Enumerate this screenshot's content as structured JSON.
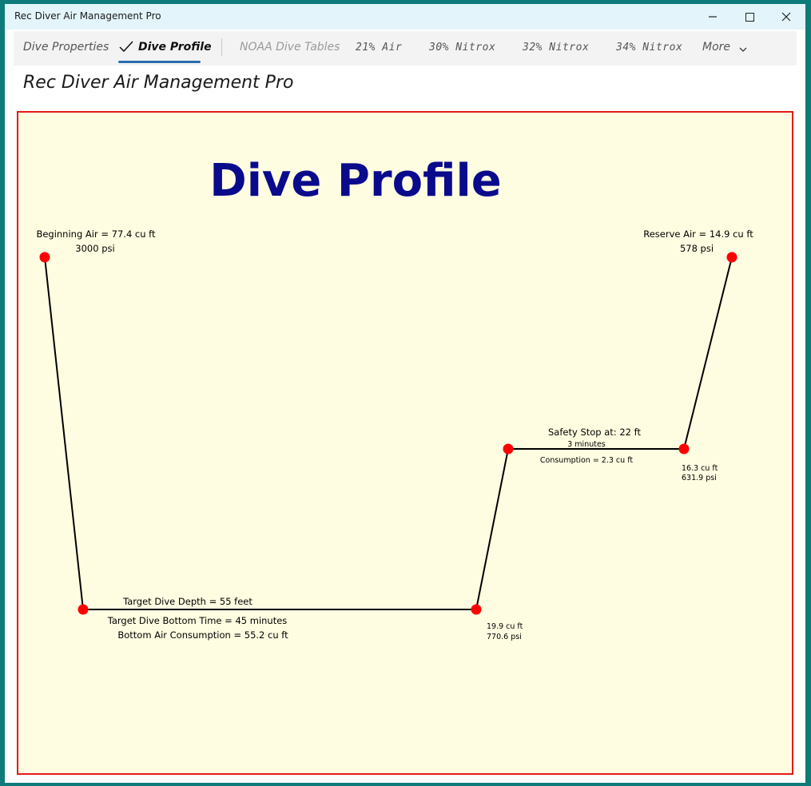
{
  "window": {
    "title": "Rec Diver Air Management Pro",
    "controls": {
      "minimize": "minimize-icon",
      "maximize": "maximize-icon",
      "close": "close-icon"
    }
  },
  "tabs": [
    {
      "label": "Dive Properties",
      "state": "normal"
    },
    {
      "label": "Dive Profile",
      "state": "selected"
    },
    {
      "label": "NOAA Dive Tables",
      "state": "disabled"
    },
    {
      "label": "21% Air",
      "state": "normal"
    },
    {
      "label": "30% Nitrox",
      "state": "normal"
    },
    {
      "label": "32% Nitrox",
      "state": "normal"
    },
    {
      "label": "34% Nitrox",
      "state": "normal"
    },
    {
      "label": "More",
      "state": "overflow"
    }
  ],
  "page_title": "Rec Diver Air Management Pro",
  "profile": {
    "heading": "Dive Profile",
    "colors": {
      "heading": "#0a0a8c",
      "point": "#ff0000",
      "line": "#000000",
      "canvas": "#fffde1",
      "frame": "#e21a1a"
    },
    "beginning": {
      "air": "Beginning Air = 77.4 cu ft",
      "psi": "3000 psi"
    },
    "bottom": {
      "depth": "Target Dive Depth = 55 feet",
      "time": "Target Dive Bottom Time = 45 minutes",
      "consumption": "Bottom Air Consumption = 55.2 cu ft"
    },
    "after_bottom": {
      "cuft": "19.9 cu ft",
      "psi": "770.6 psi"
    },
    "safety_stop": {
      "depth": "Safety Stop at: 22 ft",
      "duration": "3 minutes",
      "consumption": "Consumption = 2.3 cu ft"
    },
    "after_stop": {
      "cuft": "16.3 cu ft",
      "psi": "631.9 psi"
    },
    "reserve": {
      "air": "Reserve Air = 14.9 cu ft",
      "psi": "578 psi"
    }
  }
}
